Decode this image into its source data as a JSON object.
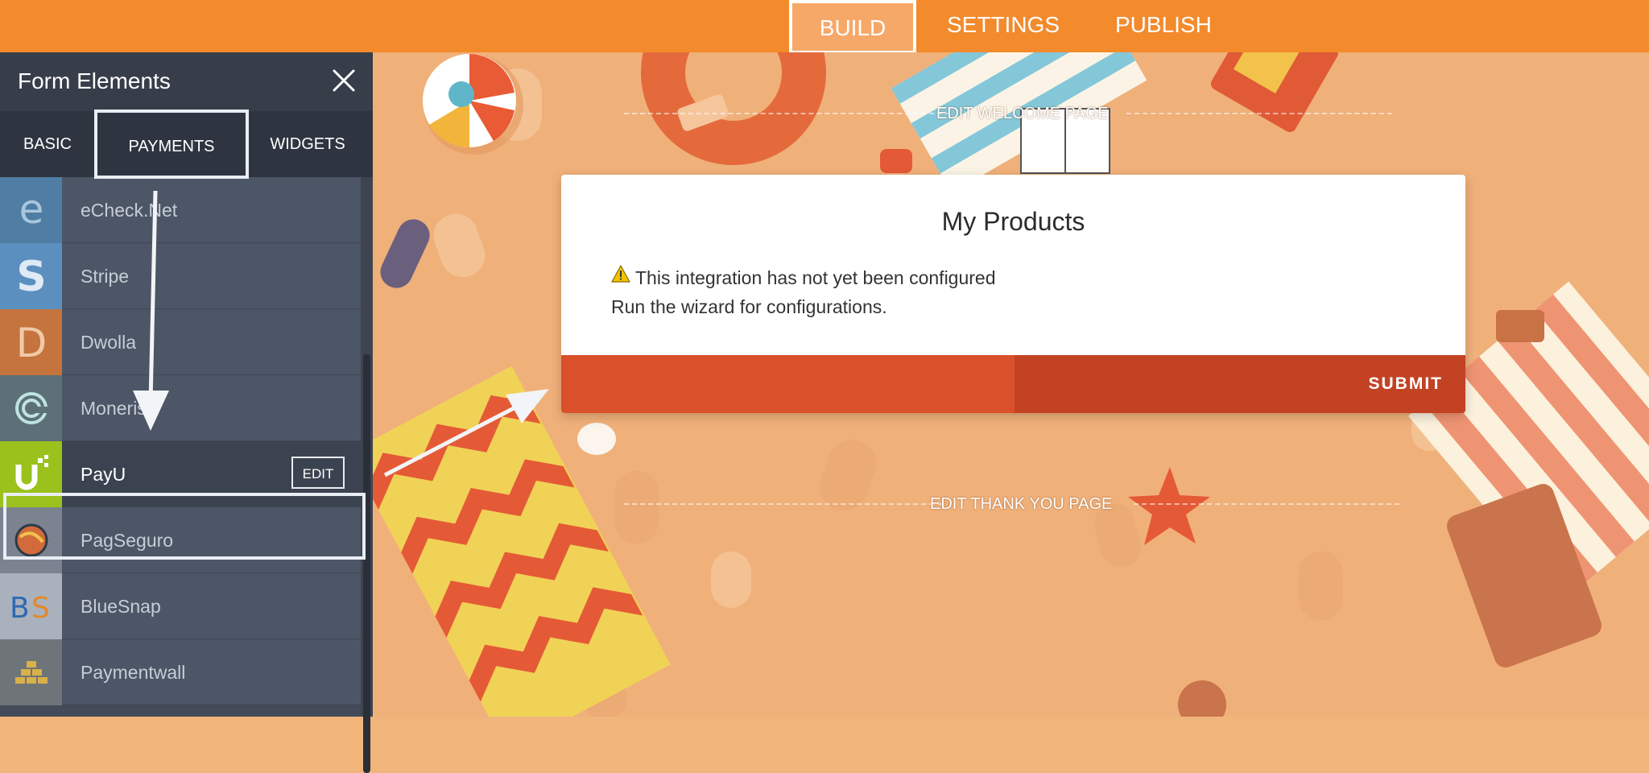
{
  "topbar": {
    "tabs": [
      {
        "label": "BUILD",
        "active": true
      },
      {
        "label": "SETTINGS",
        "active": false
      },
      {
        "label": "PUBLISH",
        "active": false
      }
    ]
  },
  "sidebar": {
    "title": "Form Elements",
    "close_icon": "close-icon",
    "tabs": [
      {
        "label": "BASIC"
      },
      {
        "label": "PAYMENTS",
        "active": true
      },
      {
        "label": "WIDGETS"
      }
    ],
    "items": [
      {
        "label": "eCheck.Net",
        "icon": "echeck-icon",
        "color": "#4f7da3"
      },
      {
        "label": "Stripe",
        "icon": "stripe-icon",
        "color": "#5b8fc0"
      },
      {
        "label": "Dwolla",
        "icon": "dwolla-icon",
        "color": "#c5743d"
      },
      {
        "label": "Moneris",
        "icon": "moneris-icon",
        "color": "#5d7077"
      },
      {
        "label": "PayU",
        "icon": "payu-icon",
        "color": "#9bc11d",
        "selected": true,
        "edit_label": "EDIT"
      },
      {
        "label": "PagSeguro",
        "icon": "pagseguro-icon",
        "color": "#7c8390"
      },
      {
        "label": "BlueSnap",
        "icon": "bluesnap-icon",
        "color": "#8e98a8"
      },
      {
        "label": "Paymentwall",
        "icon": "paymentwall-icon",
        "color": "#6e7477"
      }
    ]
  },
  "canvas": {
    "welcome_label": "EDIT WELCOME PAGE",
    "thankyou_label": "EDIT THANK YOU PAGE",
    "card": {
      "title": "My Products",
      "warning_text": "This integration has not yet been configured",
      "hint_text": "Run the wizard for configurations.",
      "submit_label": "SUBMIT"
    }
  },
  "colors": {
    "topbar": "#f38a2c",
    "accent": "#d9502b",
    "sidebar": "#4c5666"
  }
}
